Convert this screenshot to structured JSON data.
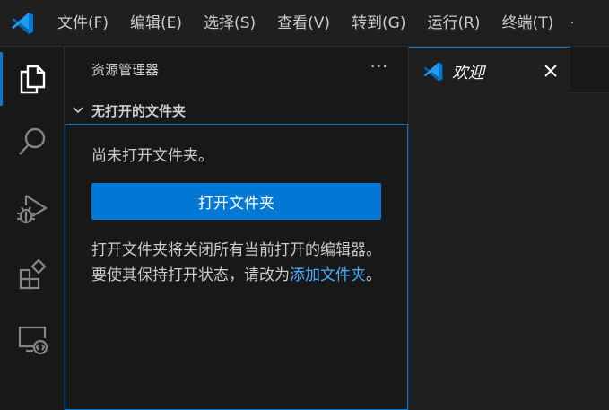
{
  "app": {
    "logo_icon": "vscode-logo-icon",
    "accent": "#0078d4"
  },
  "menubar": {
    "items": [
      "文件(F)",
      "编辑(E)",
      "选择(S)",
      "查看(V)",
      "转到(G)",
      "运行(R)",
      "终端(T)"
    ]
  },
  "activitybar": {
    "items": [
      "explorer-icon",
      "search-icon",
      "run-debug-icon",
      "extensions-icon",
      "remote-explorer-icon"
    ]
  },
  "sidebar": {
    "title": "资源管理器",
    "more_label": "···",
    "section_title": "无打开的文件夹",
    "empty_text": "尚未打开文件夹。",
    "open_folder_label": "打开文件夹",
    "info_text": "打开文件夹将关闭所有当前打开的编辑器。要使其保持打开状态，请改为",
    "info_link": "添加文件夹",
    "info_suffix": "。"
  },
  "editor": {
    "tab_label": "欢迎"
  }
}
